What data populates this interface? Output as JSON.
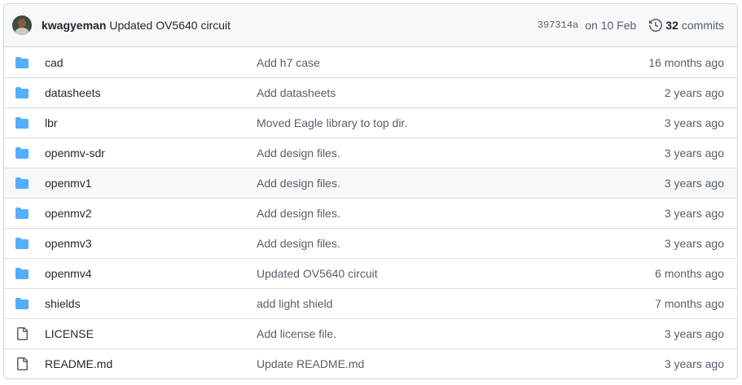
{
  "header": {
    "author": "kwagyeman",
    "message": "Updated OV5640 circuit",
    "sha": "397314a",
    "date": "on 10 Feb",
    "commit_count": "32",
    "commit_label": "commits"
  },
  "colors": {
    "folder": "#54aeff",
    "file": "#57606a",
    "header_bg": "#f6f8fa",
    "border": "#d0d7de"
  },
  "files": [
    {
      "type": "folder",
      "icon": "folder-icon",
      "name": "cad",
      "message": "Add h7 case",
      "age": "16 months ago"
    },
    {
      "type": "folder",
      "icon": "folder-icon",
      "name": "datasheets",
      "message": "Add datasheets",
      "age": "2 years ago"
    },
    {
      "type": "folder",
      "icon": "folder-icon",
      "name": "lbr",
      "message": "Moved Eagle library to top dir.",
      "age": "3 years ago"
    },
    {
      "type": "folder",
      "icon": "folder-icon",
      "name": "openmv-sdr",
      "message": "Add design files.",
      "age": "3 years ago"
    },
    {
      "type": "folder",
      "icon": "folder-icon",
      "name": "openmv1",
      "message": "Add design files.",
      "age": "3 years ago"
    },
    {
      "type": "folder",
      "icon": "folder-icon",
      "name": "openmv2",
      "message": "Add design files.",
      "age": "3 years ago"
    },
    {
      "type": "folder",
      "icon": "folder-icon",
      "name": "openmv3",
      "message": "Add design files.",
      "age": "3 years ago"
    },
    {
      "type": "folder",
      "icon": "folder-icon",
      "name": "openmv4",
      "message": "Updated OV5640 circuit",
      "age": "6 months ago"
    },
    {
      "type": "folder",
      "icon": "folder-icon",
      "name": "shields",
      "message": "add light shield",
      "age": "7 months ago"
    },
    {
      "type": "file",
      "icon": "file-icon",
      "name": "LICENSE",
      "message": "Add license file.",
      "age": "3 years ago"
    },
    {
      "type": "file",
      "icon": "file-icon",
      "name": "README.md",
      "message": "Update README.md",
      "age": "3 years ago"
    }
  ]
}
